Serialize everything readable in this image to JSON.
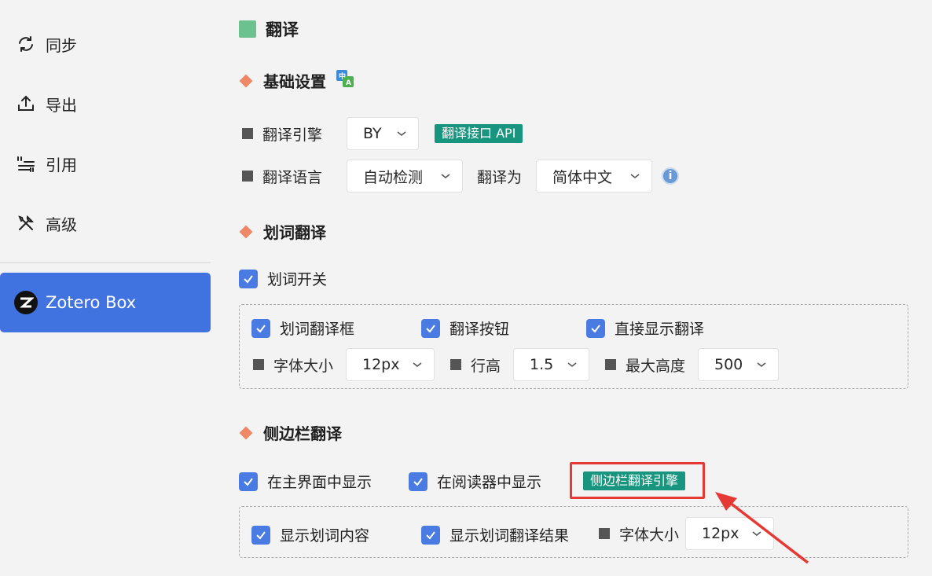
{
  "sidebar": {
    "items": [
      {
        "label": "同步",
        "icon": "sync-icon"
      },
      {
        "label": "导出",
        "icon": "export-icon"
      },
      {
        "label": "引用",
        "icon": "cite-icon"
      },
      {
        "label": "高级",
        "icon": "tools-icon"
      }
    ],
    "active": {
      "label": "Zotero Box",
      "icon": "zotero-logo-icon"
    }
  },
  "page": {
    "title": "翻译"
  },
  "basic": {
    "heading": "基础设置",
    "engine_label": "翻译引擎",
    "engine_value": "BY",
    "api_tag": "翻译接口 API",
    "lang_label": "翻译语言",
    "lang_from": "自动检测",
    "to_label": "翻译为",
    "lang_to": "简体中文"
  },
  "word": {
    "heading": "划词翻译",
    "toggle_label": "划词开关",
    "box_label": "划词翻译框",
    "button_label": "翻译按钮",
    "direct_label": "直接显示翻译",
    "font_label": "字体大小",
    "font_value": "12px",
    "line_label": "行高",
    "line_value": "1.5",
    "maxh_label": "最大高度",
    "maxh_value": "500"
  },
  "side": {
    "heading": "侧边栏翻译",
    "main_label": "在主界面中显示",
    "reader_label": "在阅读器中显示",
    "engine_tag": "侧边栏翻译引擎",
    "show_content_label": "显示划词内容",
    "show_result_label": "显示划词翻译结果",
    "font_label": "字体大小",
    "font_value": "12px"
  },
  "colors": {
    "accent": "#4173e0",
    "tag": "#17957f",
    "highlight": "#e53935",
    "diamond": "#ee8866",
    "title_square": "#6cc28f"
  }
}
